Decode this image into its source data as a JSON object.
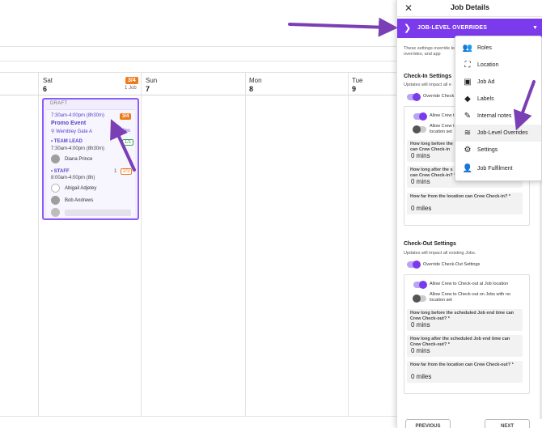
{
  "calendar": {
    "days": [
      {
        "name": "Sat",
        "num": "6"
      },
      {
        "name": "Sun",
        "num": "7"
      },
      {
        "name": "Mon",
        "num": "8"
      },
      {
        "name": "Tue",
        "num": "9"
      }
    ],
    "sat_badge": "3/4",
    "sat_jobs": "1 Job",
    "job": {
      "status": "DRAFT",
      "time": "7:30am-4:00pm (8h30m)",
      "badge": "3/4",
      "title": "Promo Event",
      "location": "Wembley Gate A",
      "location_extra": "miles",
      "team_lead": {
        "label": "TEAM LEAD",
        "time": "7:30am-4:00pm (8h30m)",
        "badge": "1/1",
        "person": "Diana Prince"
      },
      "staff": {
        "label": "STAFF",
        "time": "8:00am-4:00pm (8h)",
        "count": "1",
        "badge": "2/3",
        "people": [
          "Abigail Adjetey",
          "Bob Andrews"
        ]
      }
    }
  },
  "panel": {
    "title": "Job Details",
    "selector_label": "JOB-LEVEL OVERRIDES",
    "description": "These settings override level overrides, and app",
    "checkin": {
      "title": "Check-In Settings",
      "subtitle": "Updates will impact all e",
      "override_label": "Override Check",
      "allow_location": "Allow Crew t",
      "allow_no_location": "Allow Crew t location set",
      "fields": [
        {
          "label": "How long before the can Crew Check-in",
          "value": "0 mins"
        },
        {
          "label": "How long after the s can Crew Check-in? *",
          "value": "0 mins"
        },
        {
          "label": "How far from the location can Crew Check-in? *",
          "value": "0 miles"
        }
      ]
    },
    "checkout": {
      "title": "Check-Out Settings",
      "subtitle": "Updates will impact all existing Jobs.",
      "override_label": "Override Check-Out Settings",
      "allow_location": "Allow Crew to Check-out at Job location",
      "allow_no_location": "Allow Crew to Check-out on Jobs with no location set",
      "fields": [
        {
          "label": "How long before the scheduled Job end time can Crew Check-out? *",
          "value": "0 mins"
        },
        {
          "label": "How long after the scheduled Job end time can Crew Check-out? *",
          "value": "0 mins"
        },
        {
          "label": "How far from the location can Crew Check-out? *",
          "value": "0 miles"
        }
      ]
    },
    "previous_label": "PREVIOUS",
    "next_label": "NEXT"
  },
  "dropdown": {
    "items": [
      {
        "label": "Roles",
        "icon": "roles-icon"
      },
      {
        "label": "Location",
        "icon": "location-icon"
      },
      {
        "label": "Job Ad",
        "icon": "job-ad-icon"
      },
      {
        "label": "Labels",
        "icon": "label-icon"
      },
      {
        "label": "Internal notes",
        "icon": "note-icon"
      },
      {
        "label": "Job-Level Overrides",
        "icon": "overrides-icon"
      },
      {
        "label": "Settings",
        "icon": "settings-icon"
      },
      {
        "label": "Job Fulfilment",
        "icon": "fulfilment-icon"
      }
    ]
  },
  "colors": {
    "accent": "#7c3aed",
    "annotation": "#7b3fb5",
    "badge_orange": "#f07b1d"
  }
}
